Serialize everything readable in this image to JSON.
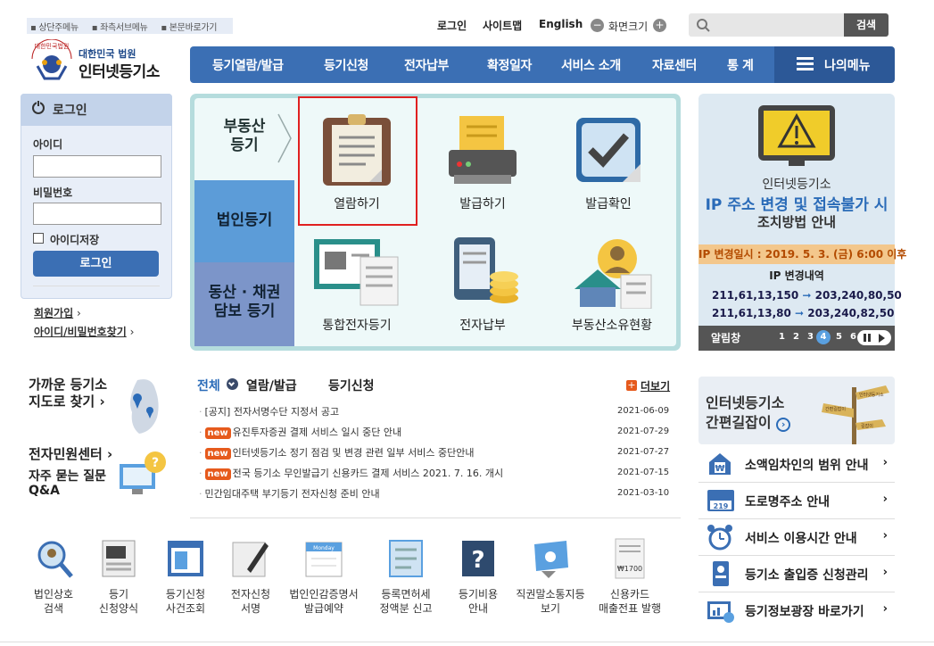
{
  "skip_links": [
    "상단주메뉴",
    "좌측서브메뉴",
    "본문바로가기"
  ],
  "util": {
    "login": "로그인",
    "sitemap": "사이트맵",
    "english": "English",
    "zoom": "화면크기",
    "minus": "−",
    "plus": "+"
  },
  "search": {
    "button": "검색",
    "placeholder": ""
  },
  "logo": {
    "top": "대한민국 법원",
    "main": "인터넷등기소",
    "emblem_text": "대한민국법원"
  },
  "nav": [
    "등기열람/발급",
    "등기신청",
    "전자납부",
    "확정일자",
    "서비스 소개",
    "자료센터",
    "통 계"
  ],
  "my_menu": "나의메뉴",
  "login": {
    "title": "로그인",
    "id_label": "아이디",
    "pw_label": "비밀번호",
    "remember": "아이디저장",
    "button": "로그인",
    "join": "회원가입",
    "find": "아이디/비밀번호찾기",
    "chev": "›"
  },
  "categories": {
    "tab1": "부동산\n등기",
    "tab2": "법인등기",
    "tab3": "동산 · 채권\n담보 등기"
  },
  "services": [
    "열람하기",
    "발급하기",
    "발급확인",
    "통합전자등기",
    "전자납부",
    "부동산소유현황"
  ],
  "ip_notice": {
    "line1": "인터넷등기소",
    "line2": "IP 주소 변경 및 접속불가 시",
    "line3": "조치방법 안내",
    "date": "IP 변경일시 : 2019. 5. 3. (금) 6:00 이후",
    "header": "IP 변경내역",
    "rows": [
      {
        "old": "211,61,13,150",
        "new": "203,240,80,50"
      },
      {
        "old": "211,61,13,80",
        "new": "203,240,82,50"
      }
    ],
    "arrow": "➞"
  },
  "alarm": {
    "label": "알림창",
    "pages": [
      "1",
      "2",
      "3",
      "4",
      "5",
      "6"
    ],
    "active": "4"
  },
  "left_links": {
    "near_office": "가까운 등기소\n지도로 찾기 ›",
    "civil": "전자민원센터 ›",
    "faq": "자주 묻는 질문\nQ&A"
  },
  "news": {
    "tabs": [
      "전체",
      "열람/발급",
      "등기신청"
    ],
    "more": "더보기",
    "new_badge": "new",
    "bullet": "·",
    "items": [
      {
        "title": "[공지] 전자서명수단 지정서 공고",
        "date": "2021-06-09",
        "new": false
      },
      {
        "title": "유진투자증권 결제 서비스 일시 중단 안내",
        "date": "2021-07-29",
        "new": true
      },
      {
        "title": "인터넷등기소 정기 점검 및 변경 관련 일부 서비스 중단안내",
        "date": "2021-07-27",
        "new": true
      },
      {
        "title": "전국 등기소 무인발급기 신용카드 결제 서비스 2021. 7. 16. 개시",
        "date": "2021-07-15",
        "new": true
      },
      {
        "title": "민간임대주택 부기등기 전자신청 준비 안내",
        "date": "2021-03-10",
        "new": false
      }
    ]
  },
  "quick": [
    "법인상호\n검색",
    "등기\n신청양식",
    "등기신청\n사건조회",
    "전자신청\n서명",
    "법인인감증명서\n발급예약",
    "등록면허세\n정액분 신고",
    "등기비용\n안내",
    "직권말소통지등\n보기",
    "신용카드\n매출전표 발행"
  ],
  "guide": {
    "line1": "인터넷등기소",
    "line2": "간편길잡이",
    "sign1": "인터넷등기소",
    "sign2": "간편길잡이",
    "sign3": "길잡이"
  },
  "right_links": [
    "소액임차인의 범위 안내",
    "도로명주소 안내",
    "서비스 이용시간 안내",
    "등기소 출입증 신청관리",
    "등기정보광장 바로가기"
  ],
  "icon_text": {
    "road_num": "219",
    "monday": "Monday",
    "won": "₩1700",
    "question": "?",
    "faq_mark": "?"
  },
  "colors": {
    "nav_blue": "#3b6fb4",
    "accent_orange": "#e65a1c",
    "ip_blue": "#2a6bb8"
  }
}
